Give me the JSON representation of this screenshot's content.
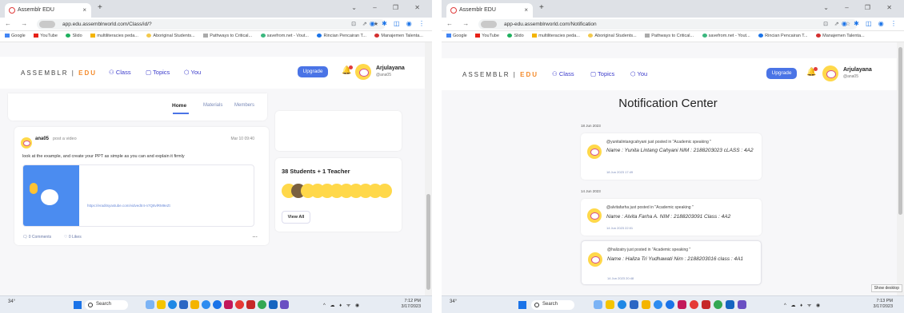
{
  "left": {
    "browser": {
      "tab_title": "Assemblr EDU",
      "close_glyph": "×",
      "new_tab_glyph": "+",
      "window_controls": "⌄ – ❐ ✕",
      "nav_glyphs": "← → ⟳",
      "url": "app.edu.assemblrworld.com/Class/id/?",
      "omni_icons": "⊡ ⇗ ★",
      "ext_icons": "◉ ✱ ◫ ◉ ⋮",
      "bookmarks": [
        "Google",
        "YouTube",
        "Slido",
        "multiliteracies peda...",
        "Aboriginal Students...",
        "Pathways to Critical...",
        "savefrom.net - Vout...",
        "Rincian Pencairan T...",
        "Manajemen Talenta..."
      ]
    },
    "header": {
      "logo_main": "ASSEMBLR",
      "logo_accent": "EDU",
      "class_label": "Class",
      "topics_label": "Topics",
      "you_label": "You",
      "upgrade_label": "Upgrade",
      "user_name": "Arjulayana",
      "user_handle": "@ana05"
    },
    "class_tabs": [
      "Home",
      "Materials",
      "Members"
    ],
    "post": {
      "author": "ana05",
      "action": "post a video",
      "date": "Mar 10 09:40",
      "body": "look at the example, and create your PPT as simple as you can and explain it firmly",
      "link": "https://eraditsyastube.com/vidvedtr4-n7Q8vlRM9eZt",
      "comments": "0 Comments",
      "likes": "0 Likes",
      "more": "..."
    },
    "members": {
      "heading": "38 Students + 1 Teacher",
      "view_all": "View All"
    },
    "taskbar": {
      "weather": "34°",
      "search": "Search",
      "tray": "^ ☁ ♦ ᯤ ◉",
      "time": "7:12 PM",
      "date": "3/17/2023"
    }
  },
  "right": {
    "browser": {
      "tab_title": "Assemblr EDU",
      "close_glyph": "×",
      "new_tab_glyph": "+",
      "window_controls": "⌄ – ❐ ✕",
      "nav_glyphs": "← → ⟳",
      "url": "app-edu.assemblrworld.com/Notification",
      "omni_icons": "⊡ ⇗ ☆",
      "ext_icons": "◉ ✱ ◫ ◉ ⋮",
      "bookmarks": [
        "Google",
        "YouTube",
        "Slido",
        "multiliteracies peda...",
        "Aboriginal Students...",
        "Pathways to Critical...",
        "savefrom.net - Yout...",
        "Rincian Pencairan T...",
        "Manajemen Talenta..."
      ]
    },
    "header": {
      "logo_main": "ASSEMBLR",
      "logo_accent": "EDU",
      "class_label": "Class",
      "topics_label": "Topics",
      "you_label": "You",
      "upgrade_label": "Upgrade",
      "user_name": "Arjulayana",
      "user_handle": "@ana05"
    },
    "page_title": "Notification Center",
    "groups": [
      {
        "date": "18 Jun 2023",
        "items": [
          {
            "who": "@yunitalintangcahyani just posted in \"Academic speaking \"",
            "text": "Name : Yunita Lintang Cahyani NIM : 2188203023 cLASS : 4A2",
            "time": "18 Jun 2023 17:49"
          }
        ]
      },
      {
        "date": "14 Jun 2023",
        "items": [
          {
            "who": "@alvitafarha just posted in \"Academic speaking \"",
            "text": "Name : Alvita Farha A. NIM : 2188203091 Class : 4A2",
            "time": "14 Jun 2023 22:01"
          },
          {
            "who": "@halizatry just posted in \"Academic speaking \"",
            "text": "Name : Haliza Tri Yudhawati Nim : 2188203016 class : 4A1",
            "time": "14 Jun 2023 20:48"
          }
        ]
      }
    ],
    "tooltip": "Show desktop",
    "taskbar": {
      "weather": "34°",
      "search": "Search",
      "tray": "^ ☁ ♦ ᯤ ◉",
      "time": "7:13 PM",
      "date": "3/17/2023"
    }
  },
  "colors": {
    "accent": "#4a74e6",
    "brand_orange": "#f48a2a",
    "avatar_yellow": "#ffd84a"
  }
}
